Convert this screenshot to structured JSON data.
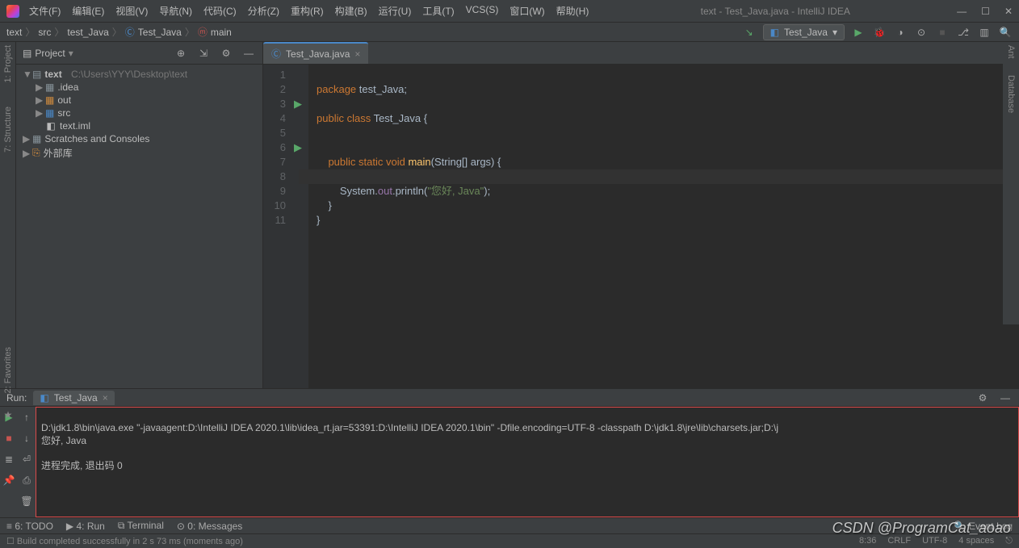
{
  "title": "text - Test_Java.java - IntelliJ IDEA",
  "menu": [
    "文件(F)",
    "编辑(E)",
    "视图(V)",
    "导航(N)",
    "代码(C)",
    "分析(Z)",
    "重构(R)",
    "构建(B)",
    "运行(U)",
    "工具(T)",
    "VCS(S)",
    "窗口(W)",
    "帮助(H)"
  ],
  "breadcrumb": [
    "text",
    "src",
    "test_Java",
    "Test_Java",
    "main"
  ],
  "runConfig": "Test_Java",
  "projectPanel": {
    "title": "Project",
    "root": {
      "name": "text",
      "path": "C:\\Users\\YYY\\Desktop\\text"
    },
    "items": [
      {
        "name": ".idea",
        "type": "folder",
        "color": "grey",
        "indent": 1,
        "arrow": "▶"
      },
      {
        "name": "out",
        "type": "folder",
        "color": "orange",
        "indent": 1,
        "arrow": "▶"
      },
      {
        "name": "src",
        "type": "folder",
        "color": "blue",
        "indent": 1,
        "arrow": "▶"
      },
      {
        "name": "text.iml",
        "type": "file",
        "indent": 1,
        "arrow": ""
      },
      {
        "name": "Scratches and Consoles",
        "type": "scratch",
        "indent": 0,
        "arrow": "▶"
      },
      {
        "name": "外部库",
        "type": "lib",
        "indent": 0,
        "arrow": "▶"
      }
    ]
  },
  "editor": {
    "tabName": "Test_Java.java",
    "lines": [
      1,
      2,
      3,
      4,
      5,
      6,
      7,
      8,
      9,
      10,
      11
    ],
    "runMarks": [
      3,
      6
    ],
    "code": {
      "l1": {
        "a": "package",
        "b": " test_Java;"
      },
      "l3": {
        "a": "public class",
        "b": " Test_Java {"
      },
      "l6": {
        "a": "public static void",
        "b": " main",
        "c": "(String[] args) {"
      },
      "l8": {
        "a": "System.",
        "b": "out",
        "c": ".println(",
        "d": "\"您好, Java\"",
        "e": ");"
      },
      "l9": "    }",
      "l10": "}"
    }
  },
  "run": {
    "label": "Run:",
    "tab": "Test_Java",
    "console": {
      "l1": "D:\\jdk1.8\\bin\\java.exe \"-javaagent:D:\\IntelliJ IDEA 2020.1\\lib\\idea_rt.jar=53391:D:\\IntelliJ IDEA 2020.1\\bin\" -Dfile.encoding=UTF-8 -classpath D:\\jdk1.8\\jre\\lib\\charsets.jar;D:\\j",
      "l2": "您好, Java",
      "l3": "",
      "l4": "进程完成, 退出码 0"
    }
  },
  "bottomTabs": [
    "≡ 6: TODO",
    "▶ 4: Run",
    "⧉ Terminal",
    "⊙ 0: Messages"
  ],
  "status": {
    "msg": "Build completed successfully in 2 s 73 ms (moments ago)",
    "eventLog": "Event Log",
    "right": [
      "8:36",
      "CRLF",
      "UTF-8",
      "4 spaces",
      "⎋"
    ]
  },
  "leftRail": [
    "1: Project",
    "7: Structure"
  ],
  "rightRail": [
    "Ant",
    "Database"
  ],
  "favRail": [
    "2: Favorites"
  ],
  "watermark": "CSDN @ProgramCat_aoao"
}
